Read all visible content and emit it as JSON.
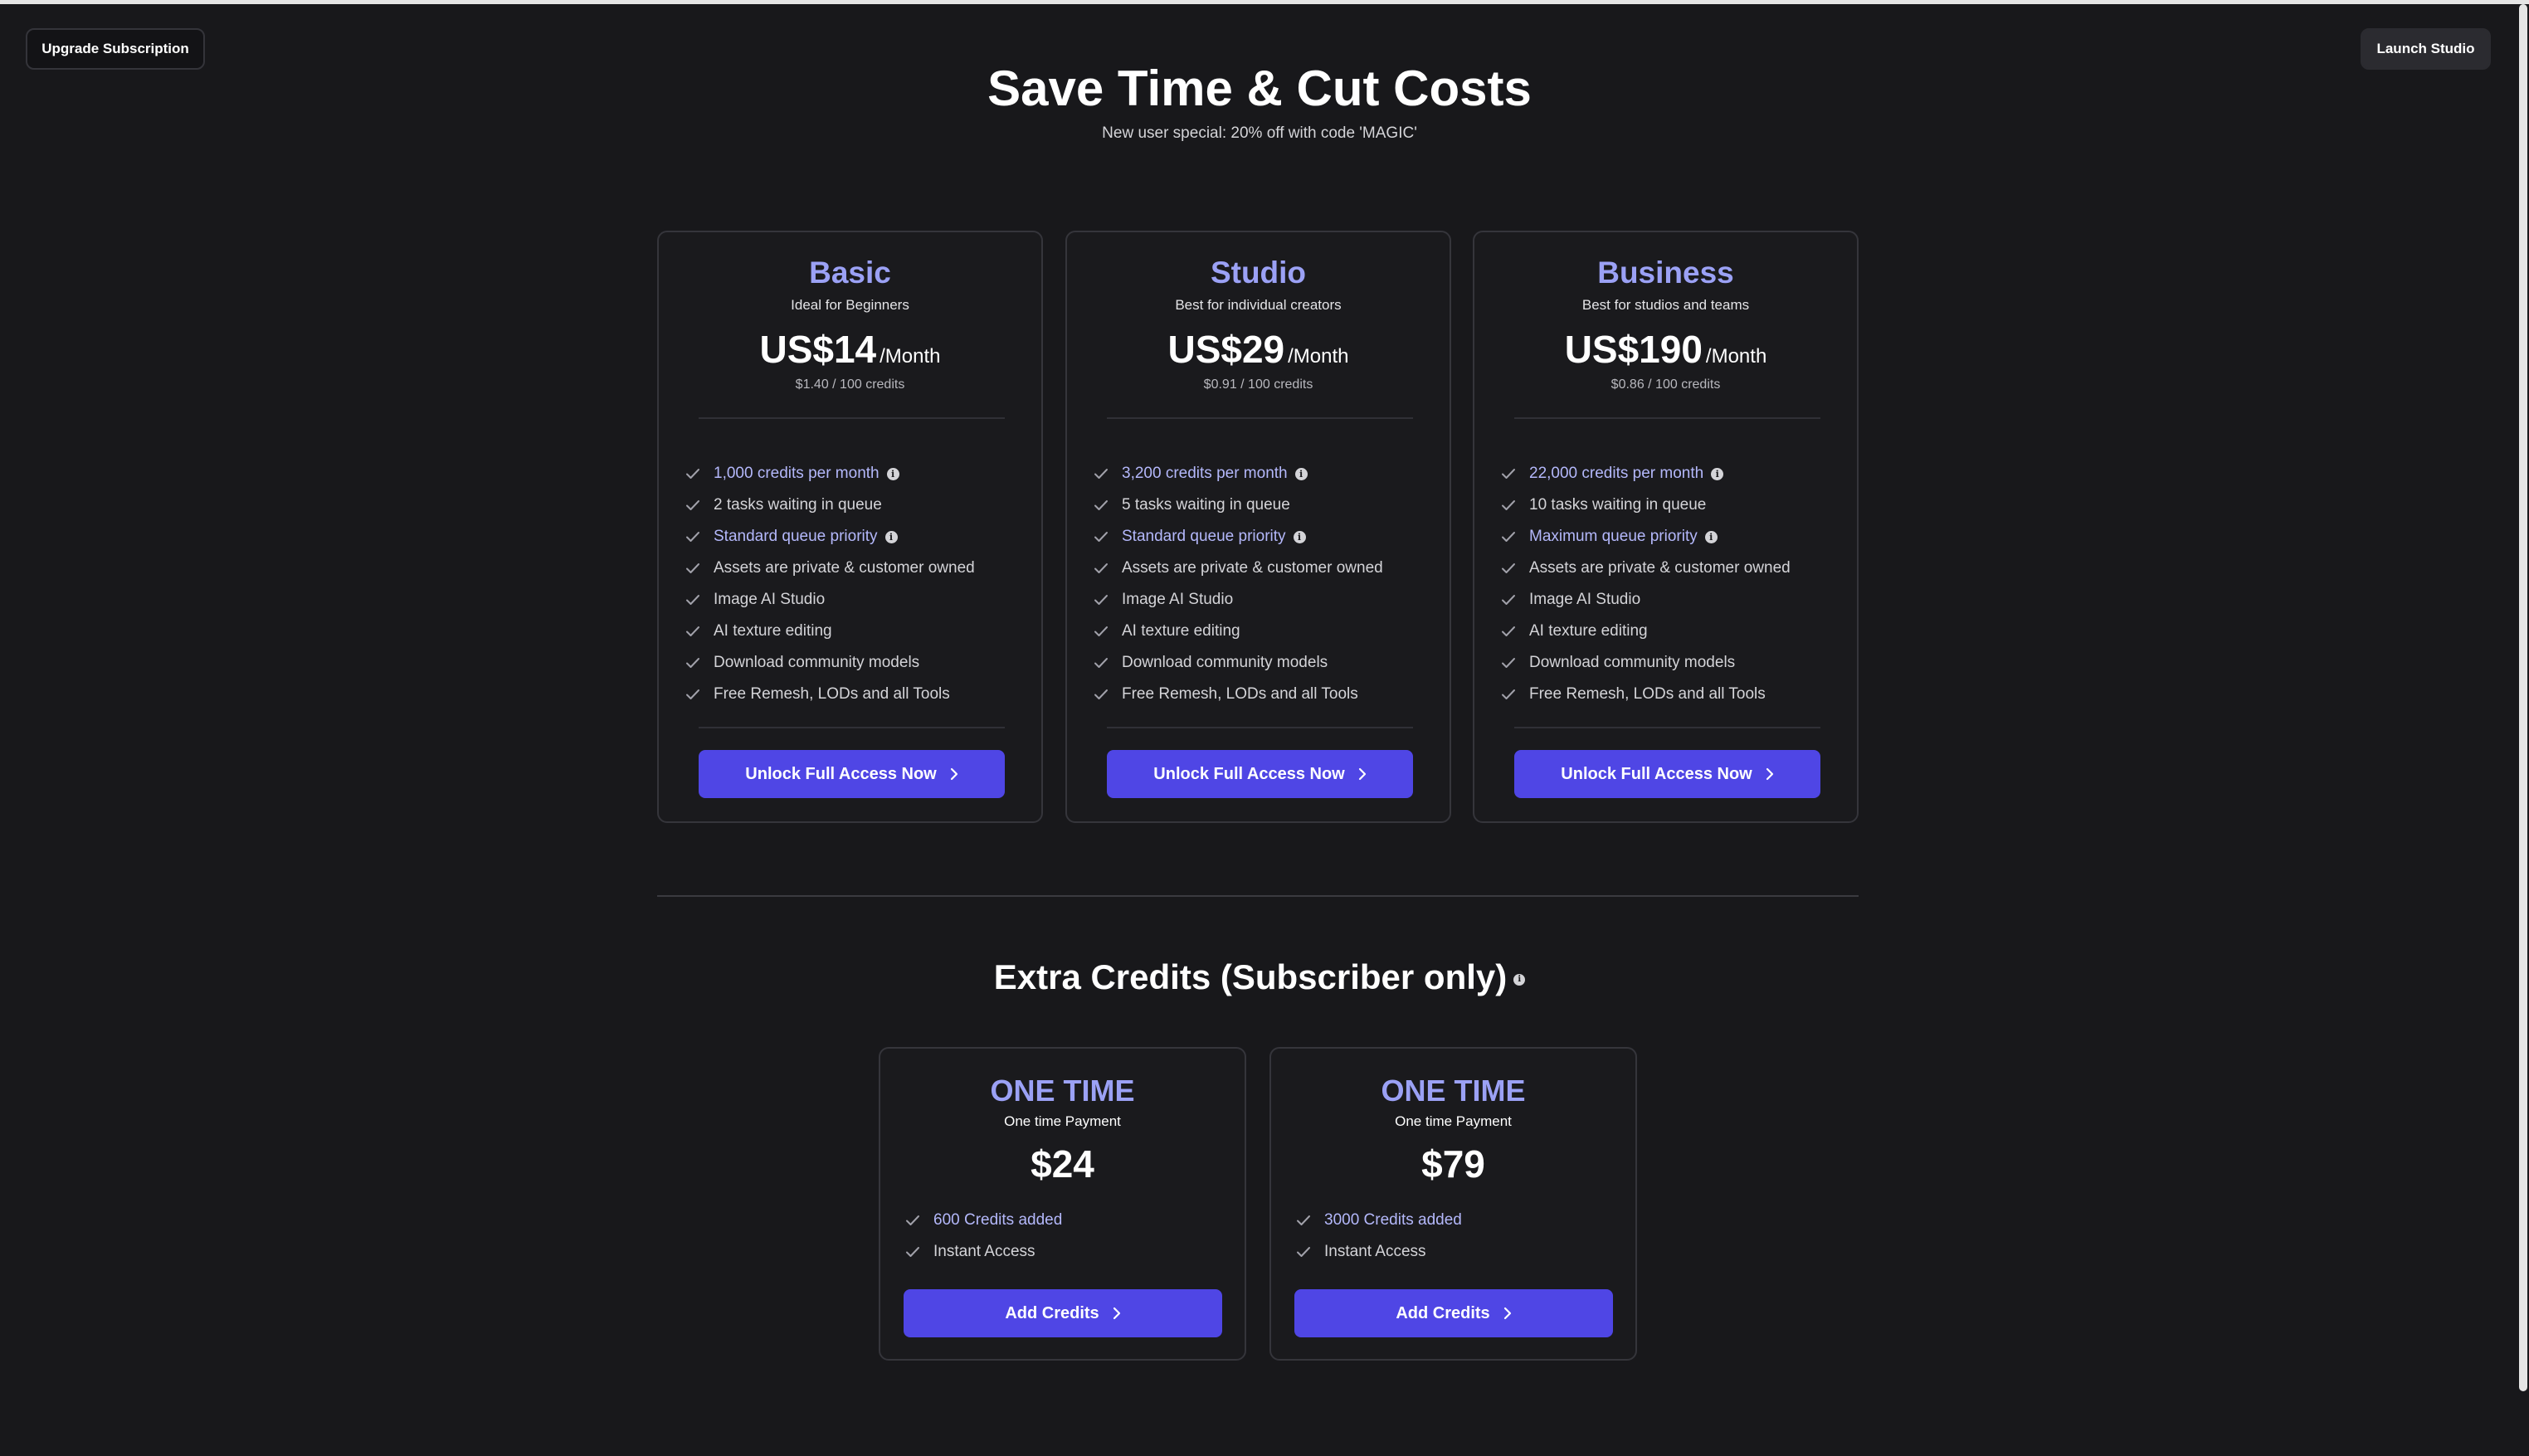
{
  "header": {
    "upgrade_label": "Upgrade Subscription",
    "launch_label": "Launch Studio",
    "title": "Save Time & Cut Costs",
    "subtitle": "New user special: 20% off with code 'MAGIC'"
  },
  "plans": [
    {
      "name": "Basic",
      "tagline": "Ideal for Beginners",
      "price": "US$14",
      "period": "/Month",
      "unit_price": "$1.40 / 100 credits",
      "features": [
        {
          "text": "1,000 credits per month",
          "highlight": true,
          "info": true
        },
        {
          "text": "2 tasks waiting in queue",
          "highlight": false,
          "info": false
        },
        {
          "text": "Standard queue priority",
          "highlight": true,
          "info": true
        },
        {
          "text": "Assets are private & customer owned",
          "highlight": false,
          "info": false
        },
        {
          "text": "Image AI Studio",
          "highlight": false,
          "info": false
        },
        {
          "text": "AI texture editing",
          "highlight": false,
          "info": false
        },
        {
          "text": "Download community models",
          "highlight": false,
          "info": false
        },
        {
          "text": "Free Remesh, LODs and all Tools",
          "highlight": false,
          "info": false
        }
      ],
      "cta": "Unlock Full Access Now"
    },
    {
      "name": "Studio",
      "tagline": "Best for individual creators",
      "price": "US$29",
      "period": "/Month",
      "unit_price": "$0.91 / 100 credits",
      "features": [
        {
          "text": "3,200 credits per month",
          "highlight": true,
          "info": true
        },
        {
          "text": "5 tasks waiting in queue",
          "highlight": false,
          "info": false
        },
        {
          "text": "Standard queue priority",
          "highlight": true,
          "info": true
        },
        {
          "text": "Assets are private & customer owned",
          "highlight": false,
          "info": false
        },
        {
          "text": "Image AI Studio",
          "highlight": false,
          "info": false
        },
        {
          "text": "AI texture editing",
          "highlight": false,
          "info": false
        },
        {
          "text": "Download community models",
          "highlight": false,
          "info": false
        },
        {
          "text": "Free Remesh, LODs and all Tools",
          "highlight": false,
          "info": false
        }
      ],
      "cta": "Unlock Full Access Now"
    },
    {
      "name": "Business",
      "tagline": "Best for studios and teams",
      "price": "US$190",
      "period": "/Month",
      "unit_price": "$0.86 / 100 credits",
      "features": [
        {
          "text": "22,000 credits per month",
          "highlight": true,
          "info": true
        },
        {
          "text": "10 tasks waiting in queue",
          "highlight": false,
          "info": false
        },
        {
          "text": "Maximum queue priority",
          "highlight": true,
          "info": true
        },
        {
          "text": "Assets are private & customer owned",
          "highlight": false,
          "info": false
        },
        {
          "text": "Image AI Studio",
          "highlight": false,
          "info": false
        },
        {
          "text": "AI texture editing",
          "highlight": false,
          "info": false
        },
        {
          "text": "Download community models",
          "highlight": false,
          "info": false
        },
        {
          "text": "Free Remesh, LODs and all Tools",
          "highlight": false,
          "info": false
        }
      ],
      "cta": "Unlock Full Access Now"
    }
  ],
  "extra_credits": {
    "title": "Extra Credits (Subscriber only)",
    "packs": [
      {
        "name": "ONE TIME",
        "payment_type": "One time Payment",
        "price": "$24",
        "features": [
          {
            "text": "600 Credits added",
            "highlight": true
          },
          {
            "text": "Instant Access",
            "highlight": false
          }
        ],
        "cta": "Add Credits"
      },
      {
        "name": "ONE TIME",
        "payment_type": "One time Payment",
        "price": "$79",
        "features": [
          {
            "text": "3000 Credits added",
            "highlight": true
          },
          {
            "text": "Instant Access",
            "highlight": false
          }
        ],
        "cta": "Add Credits"
      }
    ]
  },
  "icons": {
    "check": "check-icon",
    "info": "info-icon",
    "chevron": "chevron-right-icon"
  },
  "colors": {
    "background": "#18181b",
    "accent": "#4f46e5",
    "plan_name": "#9ba1f5",
    "highlight_text": "#b4b8fb"
  }
}
